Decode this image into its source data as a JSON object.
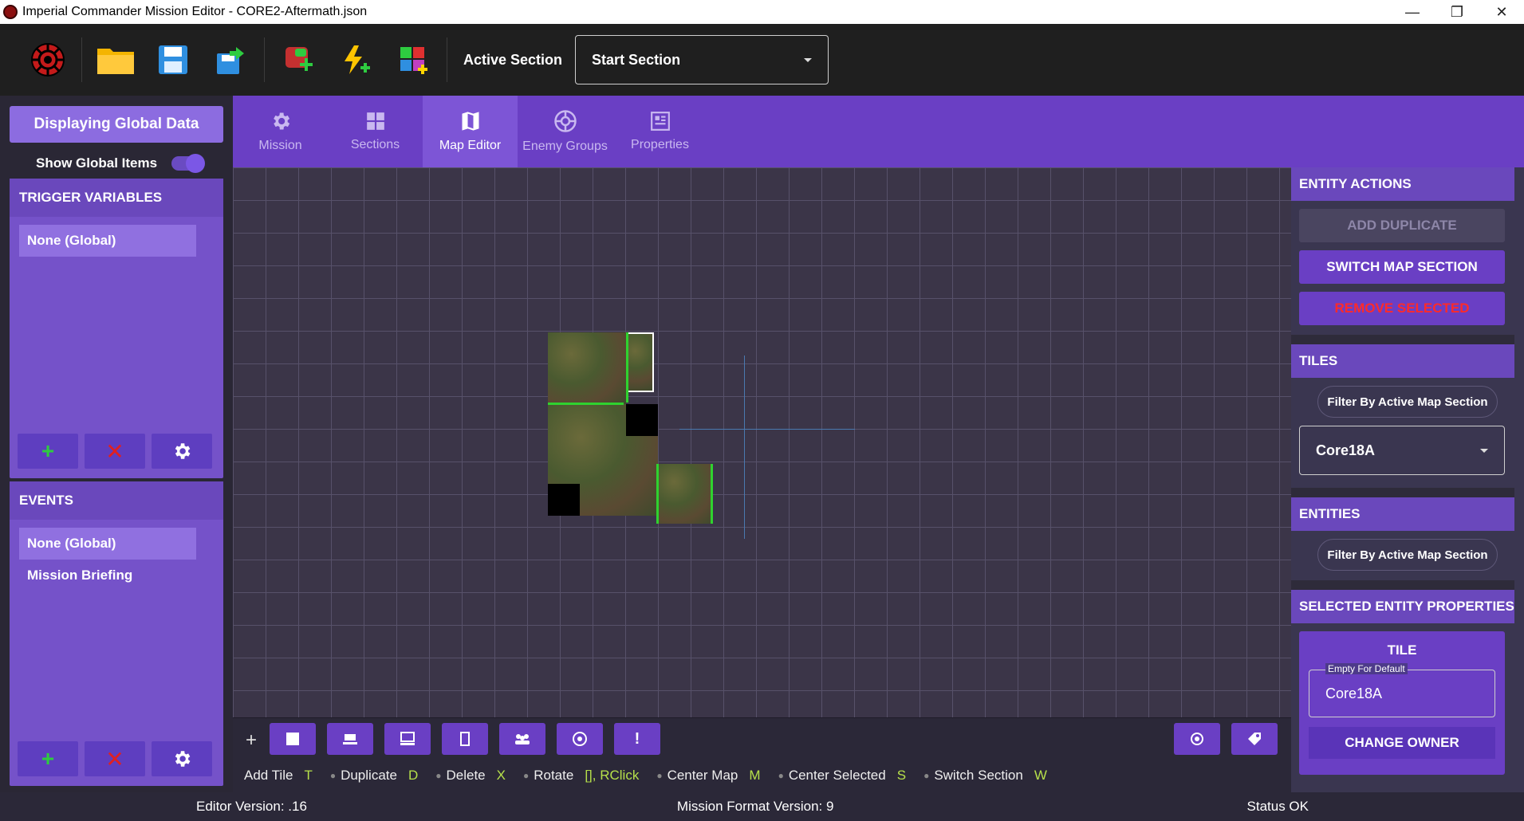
{
  "window": {
    "title": "Imperial Commander Mission Editor - CORE2-Aftermath.json"
  },
  "toolbar": {
    "active_section_label": "Active Section",
    "active_section_value": "Start Section"
  },
  "left": {
    "global_button": "Displaying Global Data",
    "show_global_label": "Show Global Items",
    "triggers": {
      "header": "TRIGGER VARIABLES",
      "items": [
        "None (Global)"
      ]
    },
    "events": {
      "header": "EVENTS",
      "items": [
        "None (Global)",
        "Mission Briefing"
      ]
    }
  },
  "tabs": [
    "Mission",
    "Sections",
    "Map Editor",
    "Enemy Groups",
    "Properties"
  ],
  "shortcuts": [
    {
      "label": "Add Tile",
      "key": "T"
    },
    {
      "label": "Duplicate",
      "key": "D"
    },
    {
      "label": "Delete",
      "key": "X"
    },
    {
      "label": "Rotate",
      "key": "[], RClick"
    },
    {
      "label": "Center Map",
      "key": "M"
    },
    {
      "label": "Center Selected",
      "key": "S"
    },
    {
      "label": "Switch Section",
      "key": "W"
    }
  ],
  "right": {
    "entity_actions": {
      "header": "ENTITY ACTIONS",
      "add_duplicate": "ADD DUPLICATE",
      "switch_map_section": "SWITCH MAP SECTION",
      "remove_selected": "REMOVE SELECTED"
    },
    "tiles": {
      "header": "TILES",
      "filter": "Filter By Active Map Section",
      "selected": "Core18A"
    },
    "entities": {
      "header": "ENTITIES",
      "filter": "Filter By Active Map Section"
    },
    "selected_props": {
      "header": "SELECTED ENTITY PROPERTIES",
      "card_title": "TILE",
      "field_hint": "Empty For Default",
      "field_value": "Core18A",
      "change_owner": "CHANGE OWNER"
    }
  },
  "status": {
    "editor_version": "Editor Version:  .16",
    "format_version": "Mission Format Version:  9",
    "status": "Status OK"
  },
  "colors": {
    "accent": "#6a3fc4",
    "header": "#6a48bc",
    "key": "#b6e04a",
    "danger": "#ff2a2a"
  }
}
